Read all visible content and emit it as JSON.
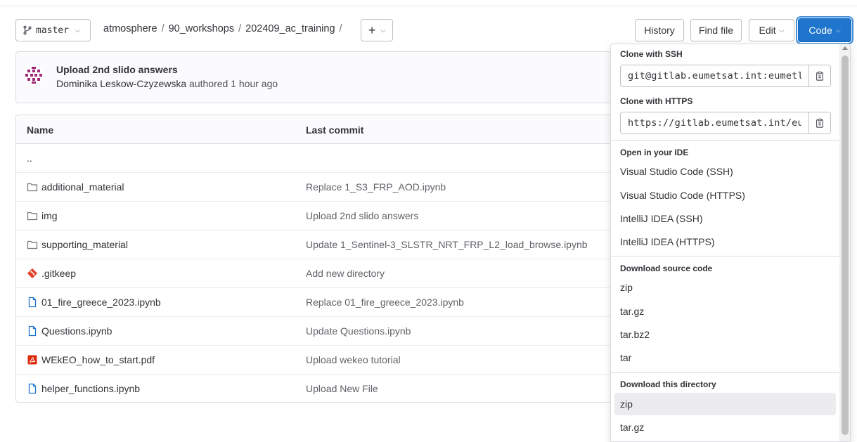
{
  "toolbar": {
    "branch": "master",
    "breadcrumb": [
      "atmosphere",
      "90_workshops",
      "202409_ac_training"
    ],
    "breadcrumb_sep": "/",
    "plus_label": "+",
    "history_label": "History",
    "find_file_label": "Find file",
    "edit_label": "Edit",
    "code_label": "Code"
  },
  "last_commit": {
    "title": "Upload 2nd slido answers",
    "author": "Dominika Leskow-Czyzewska",
    "meta_suffix": " authored 1 hour ago"
  },
  "table": {
    "headers": {
      "name": "Name",
      "last_commit": "Last commit"
    },
    "rows": [
      {
        "name": "..",
        "icon": "none",
        "commit": ""
      },
      {
        "name": "additional_material",
        "icon": "folder-icon",
        "commit": "Replace 1_S3_FRP_AOD.ipynb"
      },
      {
        "name": "img",
        "icon": "folder-icon",
        "commit": "Upload 2nd slido answers"
      },
      {
        "name": "supporting_material",
        "icon": "folder-icon",
        "commit": "Update 1_Sentinel-3_SLSTR_NRT_FRP_L2_load_browse.ipynb"
      },
      {
        "name": ".gitkeep",
        "icon": "git-icon",
        "commit": "Add new directory"
      },
      {
        "name": "01_fire_greece_2023.ipynb",
        "icon": "file-icon",
        "commit": "Replace 01_fire_greece_2023.ipynb"
      },
      {
        "name": "Questions.ipynb",
        "icon": "file-icon",
        "commit": "Update Questions.ipynb"
      },
      {
        "name": "WEkEO_how_to_start.pdf",
        "icon": "pdf-icon",
        "commit": "Upload wekeo tutorial"
      },
      {
        "name": "helper_functions.ipynb",
        "icon": "file-icon",
        "commit": "Upload New File"
      }
    ]
  },
  "dropdown": {
    "clone_ssh_label": "Clone with SSH",
    "clone_ssh_value": "git@gitlab.eumetsat.int:eumetl",
    "clone_https_label": "Clone with HTTPS",
    "clone_https_value": "https://gitlab.eumetsat.int/eu",
    "ide_label": "Open in your IDE",
    "ide_items": [
      "Visual Studio Code (SSH)",
      "Visual Studio Code (HTTPS)",
      "IntelliJ IDEA (SSH)",
      "IntelliJ IDEA (HTTPS)"
    ],
    "source_label": "Download source code",
    "source_items": [
      "zip",
      "tar.gz",
      "tar.bz2",
      "tar"
    ],
    "directory_label": "Download this directory",
    "directory_items": [
      "zip",
      "tar.gz"
    ]
  },
  "colors": {
    "primary": "#1f75cb",
    "folder": "#737278",
    "file": "#1f75cb",
    "git": "#e2432a",
    "pdf": "#dd2b0e"
  }
}
